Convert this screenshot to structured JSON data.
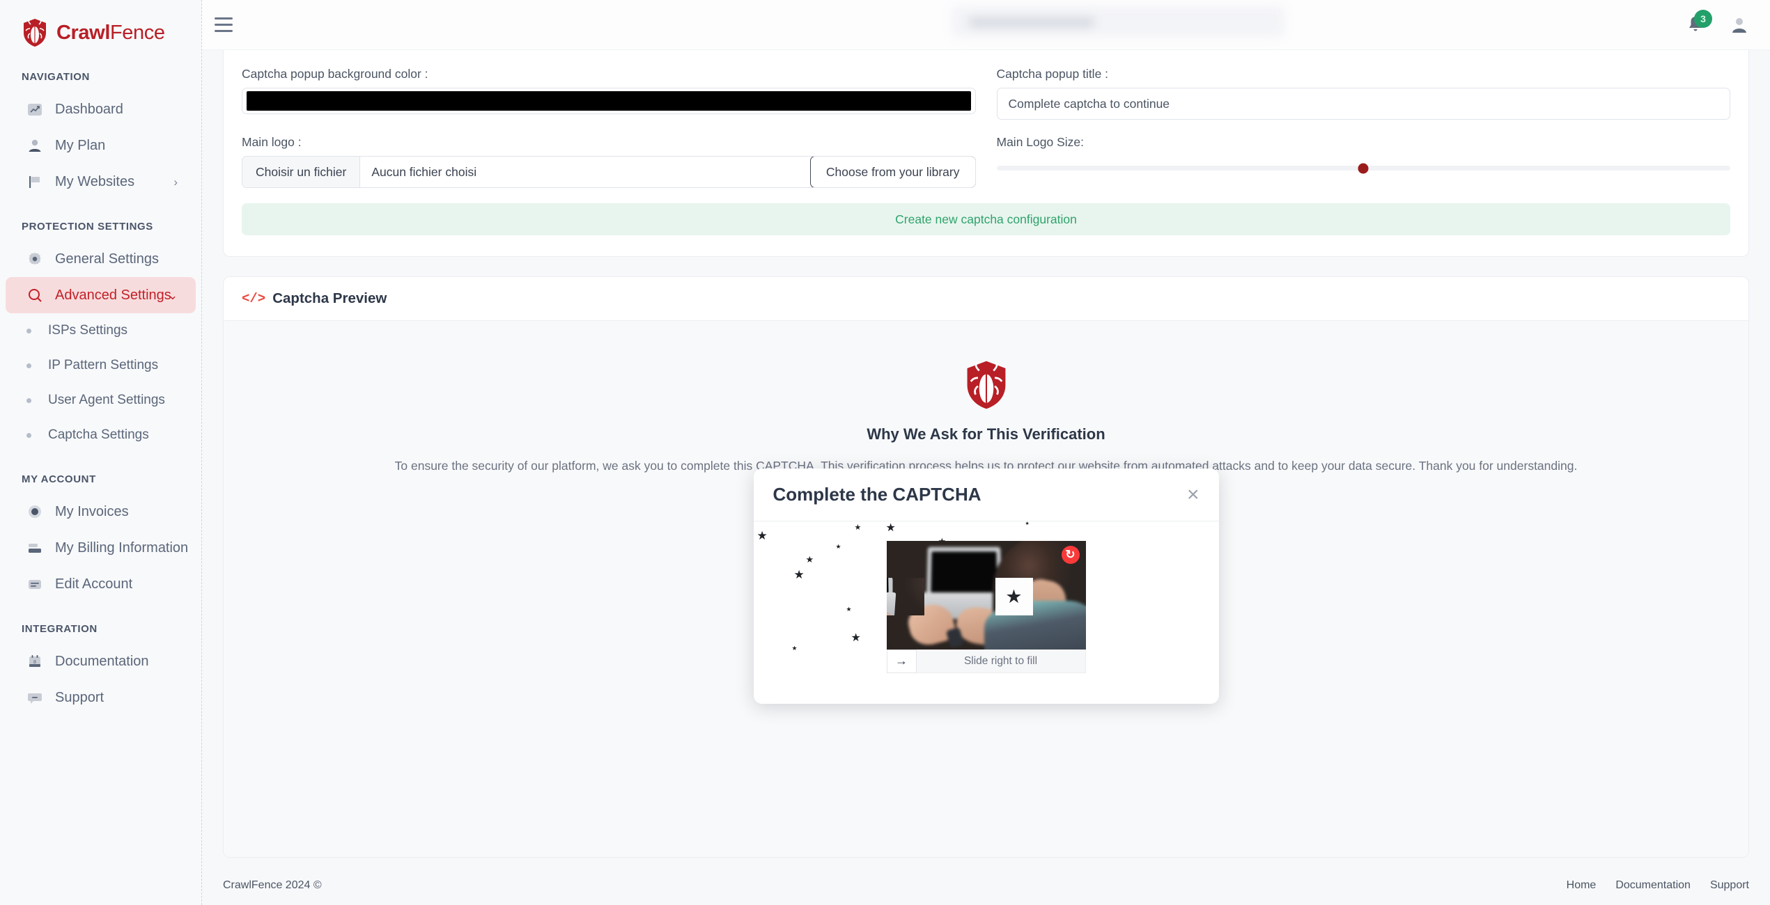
{
  "brand": {
    "name_bold": "Crawl",
    "name_light": "Fence",
    "logo_icon": "shield-bug-icon"
  },
  "sidebar": {
    "sections": [
      {
        "title": "NAVIGATION",
        "items": [
          {
            "label": "Dashboard",
            "icon": "chart-growth-icon",
            "active": false,
            "chevron": ""
          },
          {
            "label": "My Plan",
            "icon": "user-icon",
            "active": false,
            "chevron": ""
          },
          {
            "label": "My Websites",
            "icon": "flag-icon",
            "active": false,
            "chevron": "›"
          }
        ]
      },
      {
        "title": "PROTECTION SETTINGS",
        "items": [
          {
            "label": "General Settings",
            "icon": "gear-icon",
            "active": false,
            "chevron": ""
          },
          {
            "label": "Advanced Settings",
            "icon": "search-icon",
            "active": true,
            "chevron": "⌄"
          }
        ],
        "subitems": [
          {
            "label": "ISPs Settings"
          },
          {
            "label": "IP Pattern Settings"
          },
          {
            "label": "User Agent Settings"
          },
          {
            "label": "Captcha Settings"
          }
        ]
      },
      {
        "title": "MY ACCOUNT",
        "items": [
          {
            "label": "My Invoices",
            "icon": "record-circle-icon",
            "active": false,
            "chevron": ""
          },
          {
            "label": "My Billing Information",
            "icon": "card-stack-icon",
            "active": false,
            "chevron": ""
          },
          {
            "label": "Edit Account",
            "icon": "id-card-icon",
            "active": false,
            "chevron": ""
          }
        ]
      },
      {
        "title": "INTEGRATION",
        "items": [
          {
            "label": "Documentation",
            "icon": "calendar-icon",
            "active": false,
            "chevron": ""
          },
          {
            "label": "Support",
            "icon": "chat-bubble-icon",
            "active": false,
            "chevron": ""
          }
        ]
      }
    ]
  },
  "topbar": {
    "menu_icon": "hamburger-menu-icon",
    "search_placeholder": "",
    "notification_icon": "bell-icon",
    "notification_count": "3",
    "avatar_icon": "user-avatar-icon"
  },
  "form": {
    "bg_color_label": "Captcha popup background color :",
    "bg_color_value": "#000000",
    "popup_title_label": "Captcha popup title :",
    "popup_title_value": "Complete captcha to continue",
    "main_logo_label": "Main logo :",
    "file_choose_label": "Choisir un fichier",
    "file_name_value": "Aucun fichier choisi",
    "library_button_label": "Choose from your library",
    "logo_size_label": "Main Logo Size:",
    "logo_size_percent": 50,
    "create_button_label": "Create new captcha configuration"
  },
  "preview": {
    "card_title": "Captcha Preview",
    "card_icon": "code-icon",
    "logo_icon": "shield-bug-icon",
    "heading": "Why We Ask for This Verification",
    "paragraph": "To ensure the security of our platform, we ask you to complete this CAPTCHA. This verification process helps us to protect our website from automated attacks and to keep your data secure. Thank you for understanding."
  },
  "captcha_modal": {
    "title": "Complete the CAPTCHA",
    "close_icon": "close-icon",
    "refresh_icon": "refresh-icon",
    "slider_handle_icon": "arrow-right-icon",
    "slider_text": "Slide right to fill",
    "puzzle_star_glyph": "★"
  },
  "footer": {
    "copyright": "CrawlFence 2024 ©",
    "links": [
      "Home",
      "Documentation",
      "Support"
    ]
  },
  "colors": {
    "brand_red": "#b81f26",
    "active_bg": "#f7dcde",
    "green_accent": "#2fa36c",
    "badge_green": "#23a06a",
    "refresh_red": "#f93a3a"
  }
}
